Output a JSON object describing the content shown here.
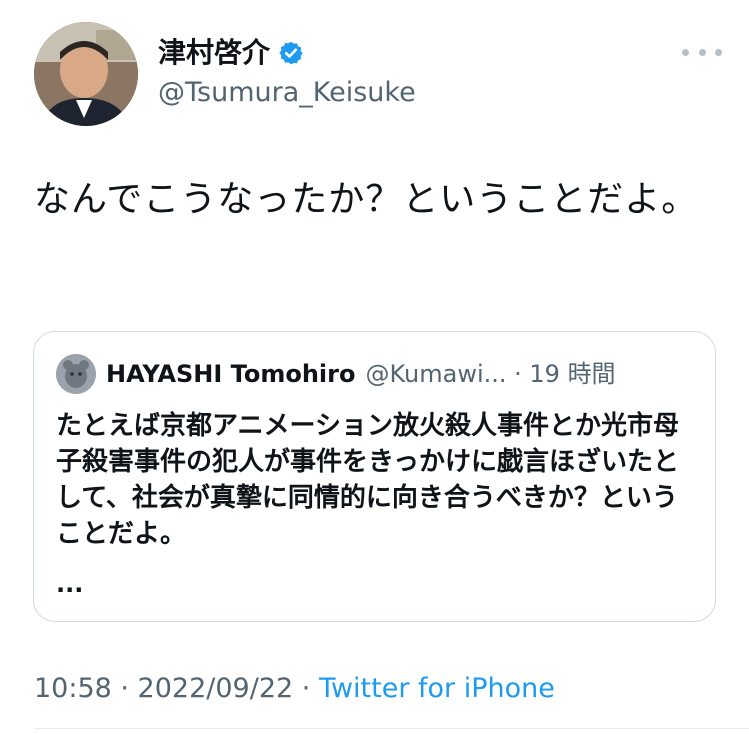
{
  "author": {
    "display_name": "津村啓介",
    "handle": "@Tsumura_Keisuke",
    "verified": true
  },
  "tweet": {
    "text": "なんでこうなったか？ということだよ。"
  },
  "quoted": {
    "display_name": "HAYASHI Tomohiro",
    "meta": "@Kumawi... · 19 時間",
    "text": "たとえば京都アニメーション放火殺人事件とか光市母子殺害事件の犯人が事件をきっかけに戯言ほざいたとして、社会が真摯に同情的に向き合うべきか？ということだよ。",
    "ellipsis": "..."
  },
  "footer": {
    "time_date": "10:58 · 2022/09/22 · ",
    "source": "Twitter for iPhone"
  },
  "colors": {
    "accent": "#1d9bf0",
    "secondary_text": "#536471",
    "border": "#cfd9de"
  }
}
